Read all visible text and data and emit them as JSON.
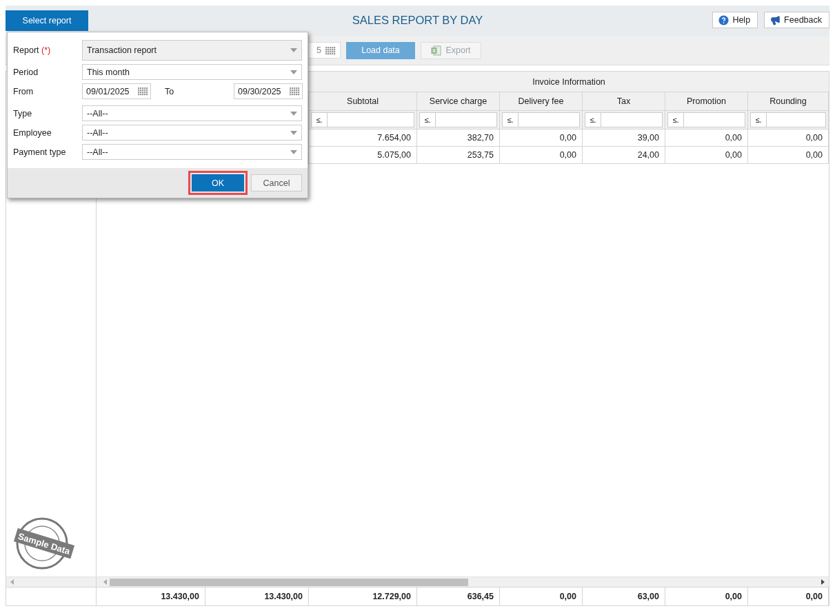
{
  "header": {
    "select_button": "Select report",
    "title": "SALES REPORT BY DAY",
    "buttons": [
      {
        "label": "Help",
        "kind": "help"
      },
      {
        "label": "Feedback",
        "kind": "feedback"
      }
    ]
  },
  "toolbar": {
    "date_field_fragment": "5",
    "buttons": [
      {
        "label": "Load data",
        "kind": "load",
        "disabled": false
      },
      {
        "label": "Export",
        "kind": "export",
        "disabled": true
      }
    ]
  },
  "table": {
    "group_header": "Invoice Information",
    "columns": [
      {
        "label": "Subtotal",
        "filter_operator": "≤."
      },
      {
        "label": "Service charge",
        "filter_operator": "≤."
      },
      {
        "label": "Delivery fee",
        "filter_operator": "≤."
      },
      {
        "label": "Tax",
        "filter_operator": "≤."
      },
      {
        "label": "Promotion",
        "filter_operator": "≤."
      },
      {
        "label": "Rounding",
        "filter_operator": "≤."
      }
    ],
    "rows": [
      [
        "7.654,00",
        "382,70",
        "0,00",
        "39,00",
        "0,00",
        "0,00"
      ],
      [
        "5.075,00",
        "253,75",
        "0,00",
        "24,00",
        "0,00",
        "0,00"
      ]
    ],
    "totals": [
      "13.430,00",
      "13.430,00",
      "12.729,00",
      "636,45",
      "0,00",
      "63,00",
      "0,00",
      "0,00"
    ]
  },
  "stamp": "Sample Data",
  "dialog": {
    "fields": [
      {
        "label": "Report",
        "required_mark": "(*)",
        "kind": "select",
        "value": "Transaction report",
        "readonly": true
      },
      {
        "label": "Period",
        "kind": "select",
        "value": "This month",
        "readonly": false
      },
      {
        "label": "From",
        "kind": "date_range",
        "value": "09/01/2025",
        "to_label": "To",
        "to_value": "09/30/2025"
      },
      {
        "label": "Type",
        "kind": "select",
        "value": "--All--",
        "readonly": false
      },
      {
        "label": "Employee",
        "kind": "select",
        "value": "--All--",
        "readonly": false
      },
      {
        "label": "Payment type",
        "kind": "select",
        "value": "--All--",
        "readonly": false
      }
    ],
    "buttons": [
      {
        "label": "OK",
        "primary": true,
        "highlighted": true
      },
      {
        "label": "Cancel",
        "primary": false,
        "highlighted": false
      }
    ]
  }
}
